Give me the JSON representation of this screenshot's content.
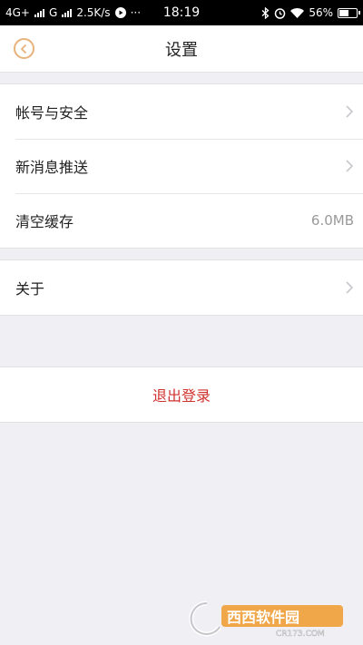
{
  "status_bar": {
    "network_1": "4G+",
    "network_2": "G",
    "speed": "2.5K/s",
    "more": "···",
    "time": "18:19",
    "battery": "56%",
    "battery_level": 0.56
  },
  "nav": {
    "title": "设置"
  },
  "settings": {
    "account_security": "帐号与安全",
    "push": "新消息推送",
    "clear_cache": "清空缓存",
    "cache_size": "6.0MB",
    "about": "关于"
  },
  "logout": {
    "label": "退出登录"
  },
  "watermark": {
    "brand": "西西软件园",
    "site": "CR173.COM"
  },
  "colors": {
    "accent": "#e8b27c",
    "logout": "#d0322d",
    "background": "#efeff4"
  }
}
